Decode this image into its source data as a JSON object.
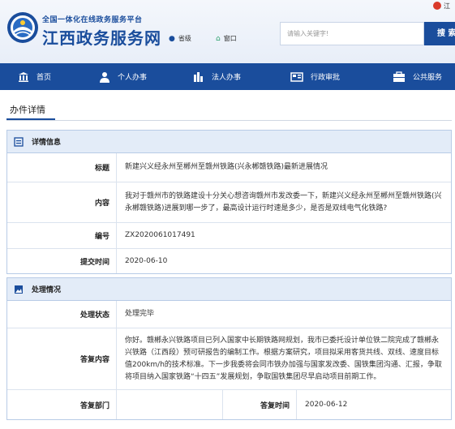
{
  "header": {
    "site_subtitle": "全国一体化在线政务服务平台",
    "site_title": "江西政务服务网",
    "location_province": "省级",
    "location_window": "窗口",
    "search_placeholder": "请输入关键字!",
    "search_button": "搜 索",
    "top_right_text": "江"
  },
  "nav": {
    "items": [
      {
        "label": "首页",
        "icon": "bank-icon"
      },
      {
        "label": "个人办事",
        "icon": "person-icon"
      },
      {
        "label": "法人办事",
        "icon": "building-icon"
      },
      {
        "label": "行政审批",
        "icon": "approval-icon"
      },
      {
        "label": "公共服务",
        "icon": "public-service-icon"
      }
    ]
  },
  "page": {
    "title": "办件详情"
  },
  "details": {
    "heading": "详情信息",
    "rows": [
      {
        "label": "标题",
        "value": "新建兴义经永州至郴州至赣州铁路(兴永郴赣铁路)最新进展情况"
      },
      {
        "label": "内容",
        "value": "我对于赣州市的铁路建设十分关心想咨询赣州市发改委一下，新建兴义经永州至郴州至赣州铁路(兴永郴赣铁路)进展到哪一步了，最高设计运行时速是多少，是否是双线电气化铁路?"
      },
      {
        "label": "编号",
        "value": "ZX2020061017491"
      },
      {
        "label": "提交时间",
        "value": "2020-06-10"
      }
    ]
  },
  "handling": {
    "heading": "处理情况",
    "status_label": "处理状态",
    "status_value": "处理完毕",
    "reply_label": "答复内容",
    "reply_value": "你好。赣郴永兴铁路项目已列入国家中长期铁路网规划，我市已委托设计单位铁二院完成了赣郴永兴铁路（江西段）预可研报告的编制工作。根据方案研究，项目拟采用客货共线、双线、速度目标值200km/h的技术标准。下一步我委将会同市铁办加强与国家发改委、国铁集团沟通、汇报，争取将项目纳入国家铁路“十四五”发展规划，争取国铁集团尽早启动项目前期工作。",
    "dept_label": "答复部门",
    "dept_value": "",
    "time_label": "答复时间",
    "time_value": "2020-06-12"
  }
}
